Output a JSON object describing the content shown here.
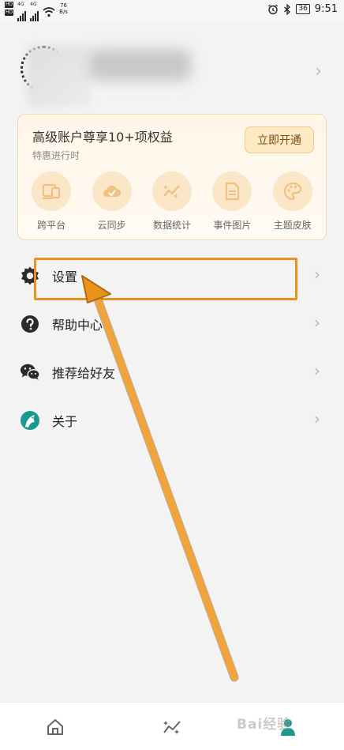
{
  "status_bar": {
    "hd_1": "HD",
    "hd_2": "HD",
    "network_1": "4G",
    "network_2": "4G",
    "speed_value": "76",
    "speed_unit": "B/s",
    "battery": "36",
    "time": "9:51"
  },
  "profile": {
    "chevron": "›"
  },
  "premium": {
    "title": "高级账户尊享10+项权益",
    "subtitle": "特惠进行时",
    "open_button": "立即开通",
    "features": [
      {
        "label": "跨平台",
        "icon": "devices-icon"
      },
      {
        "label": "云同步",
        "icon": "cloud-sync-icon"
      },
      {
        "label": "数据统计",
        "icon": "stats-icon"
      },
      {
        "label": "事件图片",
        "icon": "document-icon"
      },
      {
        "label": "主题皮肤",
        "icon": "palette-icon"
      }
    ]
  },
  "menu": [
    {
      "label": "设置",
      "icon": "gear-icon"
    },
    {
      "label": "帮助中心",
      "icon": "help-icon"
    },
    {
      "label": "推荐给好友",
      "icon": "wechat-icon"
    },
    {
      "label": "关于",
      "icon": "app-logo-icon"
    }
  ],
  "menu_chevron": "›",
  "bottom_nav": [
    {
      "icon": "home-icon"
    },
    {
      "icon": "trend-icon"
    },
    {
      "icon": "profile-icon"
    }
  ],
  "watermark": "Bai经验",
  "colors": {
    "accent_orange": "#e9931b",
    "premium_icon_bg": "#fbe6c8",
    "premium_icon_fg": "#f3c98a",
    "teal": "#1a9a8e"
  }
}
